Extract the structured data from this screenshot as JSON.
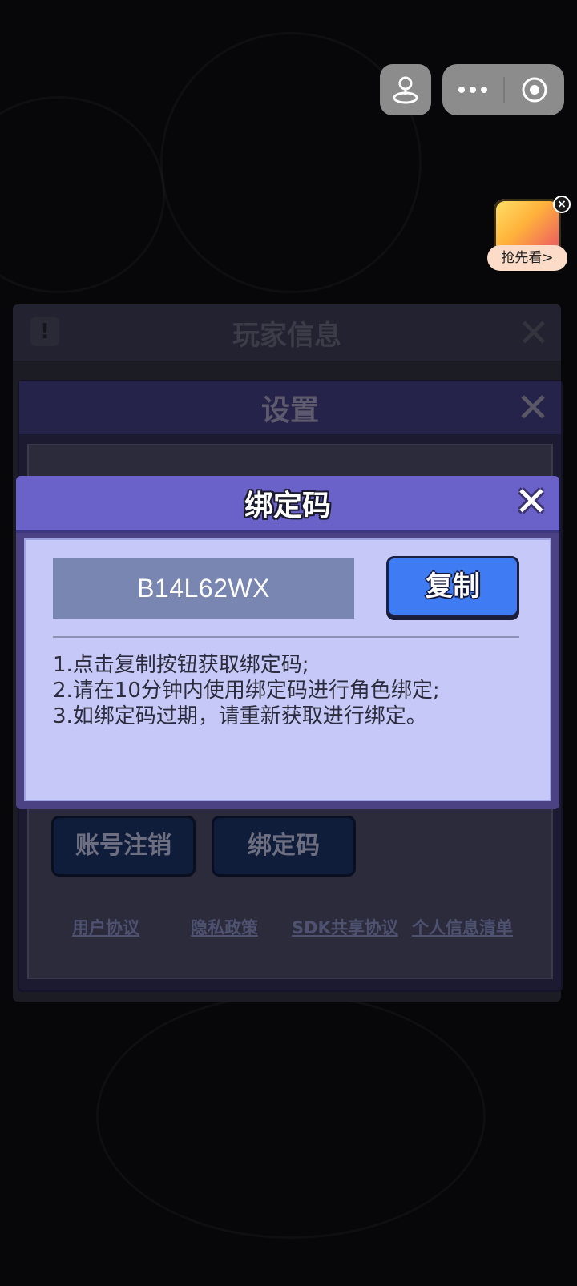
{
  "player_panel": {
    "title": "玩家信息"
  },
  "settings_panel": {
    "title": "设置",
    "buttons": [
      "账号注销",
      "绑定码"
    ],
    "links": [
      "用户协议",
      "隐私政策",
      "SDK共享协议",
      "个人信息清单"
    ]
  },
  "bind_dialog": {
    "title": "绑定码",
    "code": "B14L62WX",
    "copy_label": "复制",
    "instructions": [
      "1.点击复制按钮获取绑定码;",
      "2.请在10分钟内使用绑定码进行角色绑定;",
      "3.如绑定码过期，请重新获取进行绑定。"
    ]
  },
  "promo": {
    "label": "抢先看>"
  },
  "icons": {
    "capsule_more": "more-icon",
    "capsule_close": "target-icon",
    "avatar": "joystick-icon"
  }
}
